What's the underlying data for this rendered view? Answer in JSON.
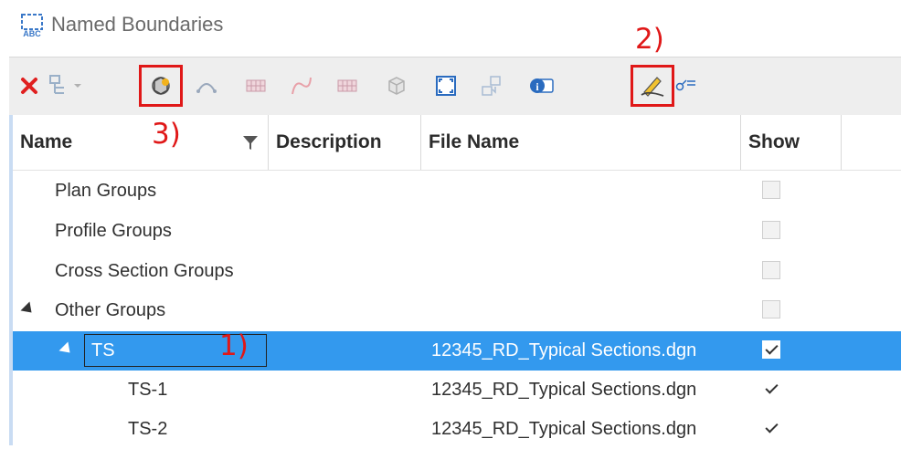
{
  "window": {
    "title": "Named Boundaries"
  },
  "annotations": {
    "step1": "1)",
    "step2": "2)",
    "step3": "3)"
  },
  "columns": {
    "name": "Name",
    "description": "Description",
    "file_name": "File Name",
    "show": "Show"
  },
  "rows": [
    {
      "name": "Plan Groups",
      "file": "",
      "show": false
    },
    {
      "name": "Profile Groups",
      "file": "",
      "show": false
    },
    {
      "name": "Cross Section Groups",
      "file": "",
      "show": false
    },
    {
      "name": "Other Groups",
      "file": "",
      "show": false
    },
    {
      "name": "TS",
      "file": "12345_RD_Typical Sections.dgn",
      "show": true
    },
    {
      "name": "TS-1",
      "file": "12345_RD_Typical Sections.dgn",
      "show": true
    },
    {
      "name": "TS-2",
      "file": "12345_RD_Typical Sections.dgn",
      "show": true
    }
  ],
  "colors": {
    "selection": "#3399ee",
    "annotation_red": "#e01818",
    "delete_red": "#e02020"
  }
}
